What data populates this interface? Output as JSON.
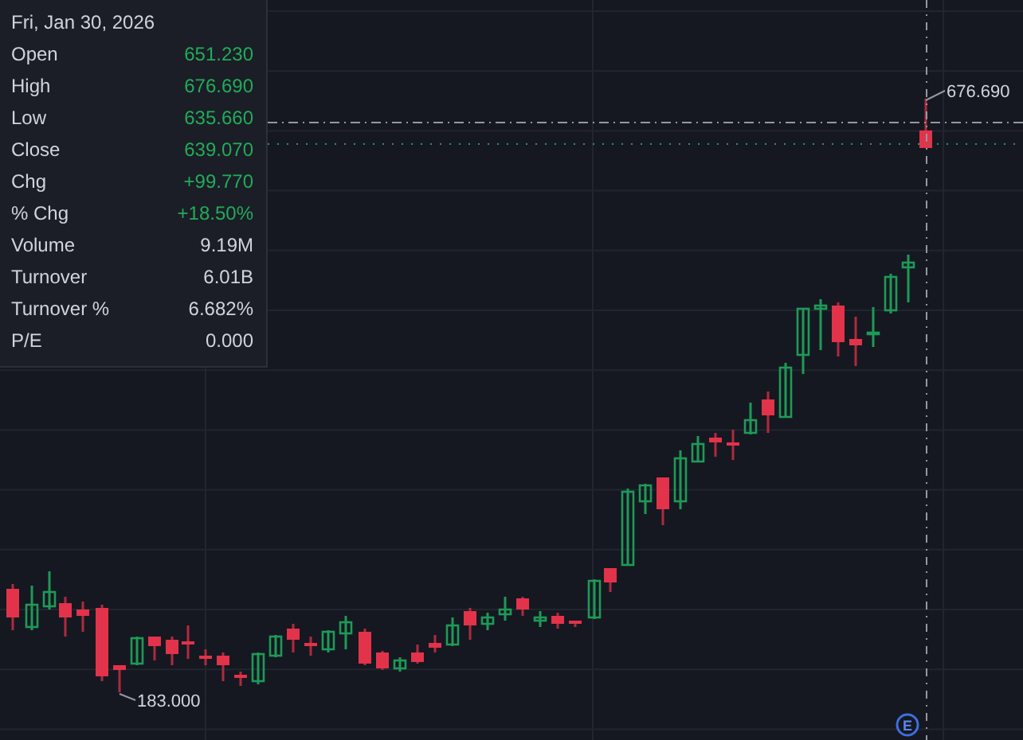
{
  "tooltip": {
    "date": "Fri, Jan 30, 2026",
    "rows": [
      {
        "label": "Open",
        "value": "651.230",
        "kind": "up"
      },
      {
        "label": "High",
        "value": "676.690",
        "kind": "up"
      },
      {
        "label": "Low",
        "value": "635.660",
        "kind": "up"
      },
      {
        "label": "Close",
        "value": "639.070",
        "kind": "up"
      },
      {
        "label": "Chg",
        "value": "+99.770",
        "kind": "up"
      },
      {
        "label": "% Chg",
        "value": "+18.50%",
        "kind": "up"
      },
      {
        "label": "Volume",
        "value": "9.19M",
        "kind": "plain"
      },
      {
        "label": "Turnover",
        "value": "6.01B",
        "kind": "plain"
      },
      {
        "label": "Turnover %",
        "value": "6.682%",
        "kind": "plain"
      },
      {
        "label": "P/E",
        "value": "0.000",
        "kind": "plain"
      }
    ]
  },
  "chart": {
    "high_marker": "676.690",
    "low_marker": "183.000",
    "event_marker": "E"
  }
}
